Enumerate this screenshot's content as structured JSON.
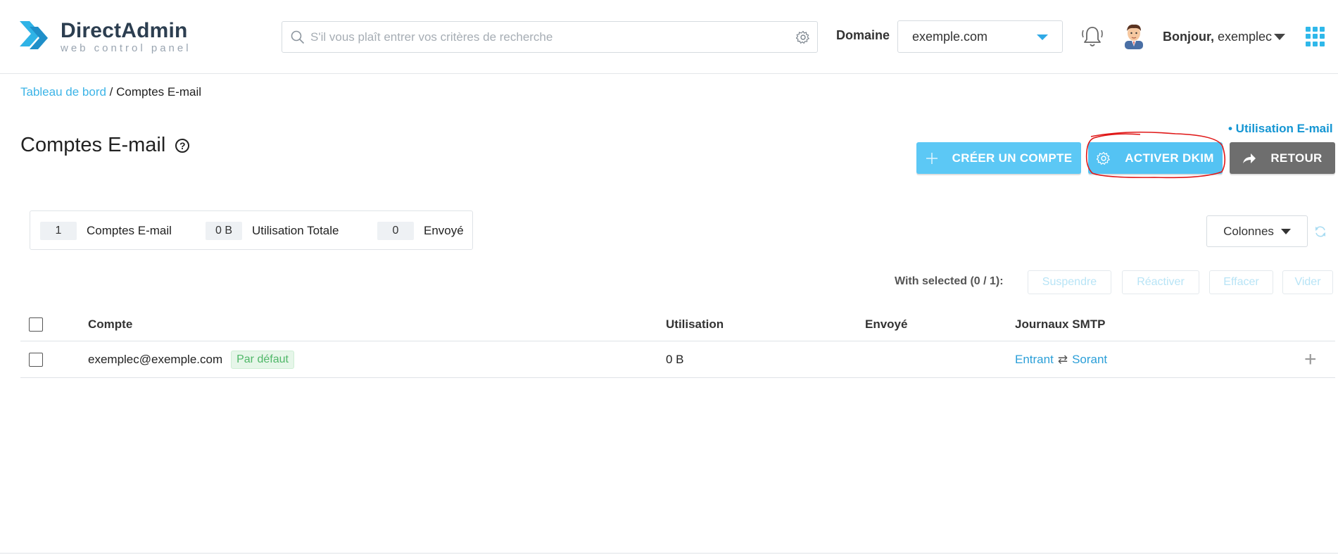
{
  "header": {
    "logo_title": "DirectAdmin",
    "logo_subtitle": "web control panel",
    "search_placeholder": "S'il vous plaît entrer vos critères de recherche",
    "domain_label": "Domaine",
    "domain_value": "exemple.com",
    "greeting_prefix": "Bonjour,",
    "username": "exemplec"
  },
  "breadcrumb": {
    "home": "Tableau de bord",
    "separator": "/",
    "current": "Comptes E-mail"
  },
  "page": {
    "title": "Comptes E-mail",
    "help_symbol": "?",
    "usage_link": "• Utilisation E-mail"
  },
  "buttons": {
    "create": "CRÉER UN COMPTE",
    "dkim": "ACTIVER DKIM",
    "back": "RETOUR"
  },
  "stats": [
    {
      "value": "1",
      "label": "Comptes E-mail"
    },
    {
      "value": "0 B",
      "label": "Utilisation Totale"
    },
    {
      "value": "0",
      "label": "Envoyé"
    }
  ],
  "toolbar": {
    "columns_label": "Colonnes",
    "with_selected": "With selected (0 / 1):",
    "bulk_actions": [
      "Suspendre",
      "Réactiver",
      "Effacer",
      "Vider"
    ]
  },
  "table": {
    "headers": {
      "account": "Compte",
      "usage": "Utilisation",
      "sent": "Envoyé",
      "smtp_logs": "Journaux SMTP"
    },
    "rows": [
      {
        "account": "exemplec@exemple.com",
        "badge": "Par défaut",
        "usage": "0 B",
        "sent": "",
        "incoming": "Entrant",
        "arrows": "⇄",
        "outgoing": "Sorant",
        "action_symbol": "+"
      }
    ]
  },
  "colors": {
    "accent": "#54c3f3",
    "link": "#3cb4e7",
    "back_button": "#6e6e6e",
    "annotation": "#e01818"
  }
}
